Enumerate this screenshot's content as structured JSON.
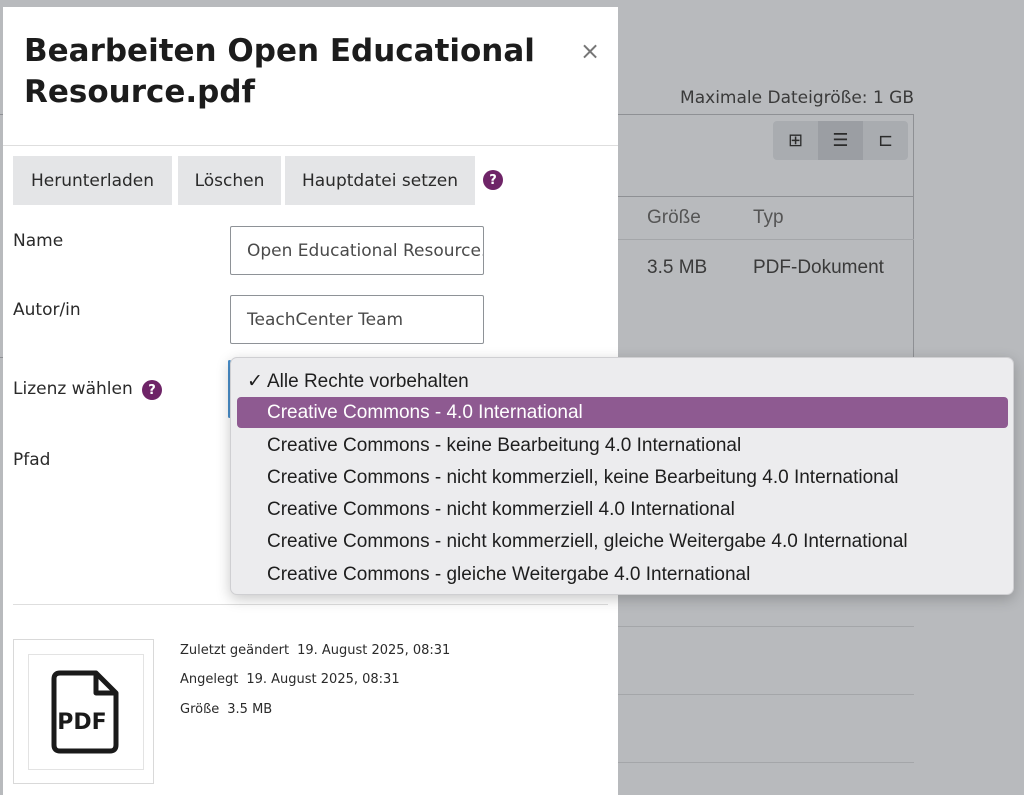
{
  "background": {
    "max_filesize_label": "Maximale Dateigröße: 1 GB",
    "view_buttons": [
      {
        "icon": "grid-icon",
        "glyph": "⊞"
      },
      {
        "icon": "list-icon",
        "glyph": "☰"
      },
      {
        "icon": "tree-icon",
        "glyph": "⊏"
      }
    ],
    "columns": {
      "size": "Größe",
      "type": "Typ"
    },
    "file_row": {
      "size": "3.5 MB",
      "type": "PDF-Dokument"
    }
  },
  "modal": {
    "title": "Bearbeiten Open Educational Resource.pdf",
    "close_glyph": "×",
    "buttons": {
      "download": "Herunterladen",
      "delete": "Löschen",
      "set_main": "Hauptdatei setzen"
    },
    "help_glyph": "?",
    "fields": {
      "name_label": "Name",
      "name_value": "Open Educational Resource.pdf",
      "author_label": "Autor/in",
      "author_value": "TeachCenter Team",
      "license_label": "Lizenz wählen",
      "path_label": "Pfad"
    },
    "file_icon": {
      "icon": "pdf-file-icon",
      "text": "PDF"
    },
    "meta": {
      "modified_label": "Zuletzt geändert",
      "modified_value": "19. August 2025, 08:31",
      "created_label": "Angelegt",
      "created_value": "19. August 2025, 08:31",
      "size_label": "Größe",
      "size_value": "3.5 MB"
    }
  },
  "license_dropdown": {
    "checked_glyph": "✓",
    "options": [
      "Alle Rechte vorbehalten",
      "Creative Commons - 4.0 International",
      "Creative Commons - keine Bearbeitung 4.0 International",
      "Creative Commons - nicht kommerziell, keine Bearbeitung 4.0 International",
      "Creative Commons - nicht kommerziell 4.0 International",
      "Creative Commons - nicht kommerziell, gleiche Weitergabe 4.0 International",
      "Creative Commons - gleiche Weitergabe 4.0 International"
    ],
    "checked_index": 0,
    "highlighted_index": 1
  },
  "colors": {
    "accent": "#6e2467",
    "highlight": "#8e5a91"
  }
}
